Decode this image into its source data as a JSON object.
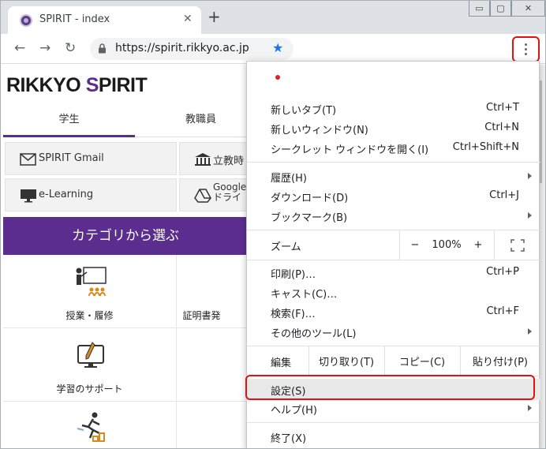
{
  "tab": {
    "title": "SPIRIT - index",
    "close": "✕",
    "new": "+"
  },
  "window": {
    "minimize": "▭",
    "maximize": "▢",
    "close": "✕"
  },
  "toolbar": {
    "back": "←",
    "forward": "→",
    "reload": "↻",
    "url": "https://spirit.rikkyo.ac.jp",
    "star": "★"
  },
  "page": {
    "logo_a": "RIKKYO ",
    "logo_b": "S",
    "logo_c": "PIRIT",
    "tabs": [
      "学生",
      "教職員"
    ],
    "quick": [
      {
        "label": "SPIRIT Gmail",
        "icon": "mail-icon"
      },
      {
        "label": "立教時",
        "icon": "building-icon"
      },
      {
        "label": "e-Learning",
        "icon": "monitor-icon"
      },
      {
        "label": "Google",
        "label2": "ドライ",
        "icon": "drive-icon"
      }
    ],
    "band": "カテゴリから選ぶ",
    "categories": [
      "授業・履修",
      "証明書発",
      "学習のサポート"
    ]
  },
  "menu": {
    "items": {
      "new_tab": {
        "label": "新しいタブ(T)",
        "shortcut": "Ctrl+T"
      },
      "new_window": {
        "label": "新しいウィンドウ(N)",
        "shortcut": "Ctrl+N"
      },
      "incognito": {
        "label": "シークレット ウィンドウを開く(I)",
        "shortcut": "Ctrl+Shift+N"
      },
      "history": {
        "label": "履歴(H)"
      },
      "downloads": {
        "label": "ダウンロード(D)",
        "shortcut": "Ctrl+J"
      },
      "bookmarks": {
        "label": "ブックマーク(B)"
      },
      "zoom": {
        "label": "ズーム",
        "minus": "−",
        "value": "100%",
        "plus": "+"
      },
      "print": {
        "label": "印刷(P)…",
        "shortcut": "Ctrl+P"
      },
      "cast": {
        "label": "キャスト(C)…"
      },
      "find": {
        "label": "検索(F)…",
        "shortcut": "Ctrl+F"
      },
      "more_tools": {
        "label": "その他のツール(L)"
      },
      "edit": {
        "label": "編集",
        "cut": "切り取り(T)",
        "copy": "コピー(C)",
        "paste": "貼り付け(P)"
      },
      "settings": {
        "label": "設定(S)"
      },
      "help": {
        "label": "ヘルプ(H)"
      },
      "exit": {
        "label": "終了(X)"
      }
    }
  },
  "colors": {
    "accent": "#5b2d8e",
    "highlight": "#e5110f",
    "star": "#1a73e8"
  }
}
